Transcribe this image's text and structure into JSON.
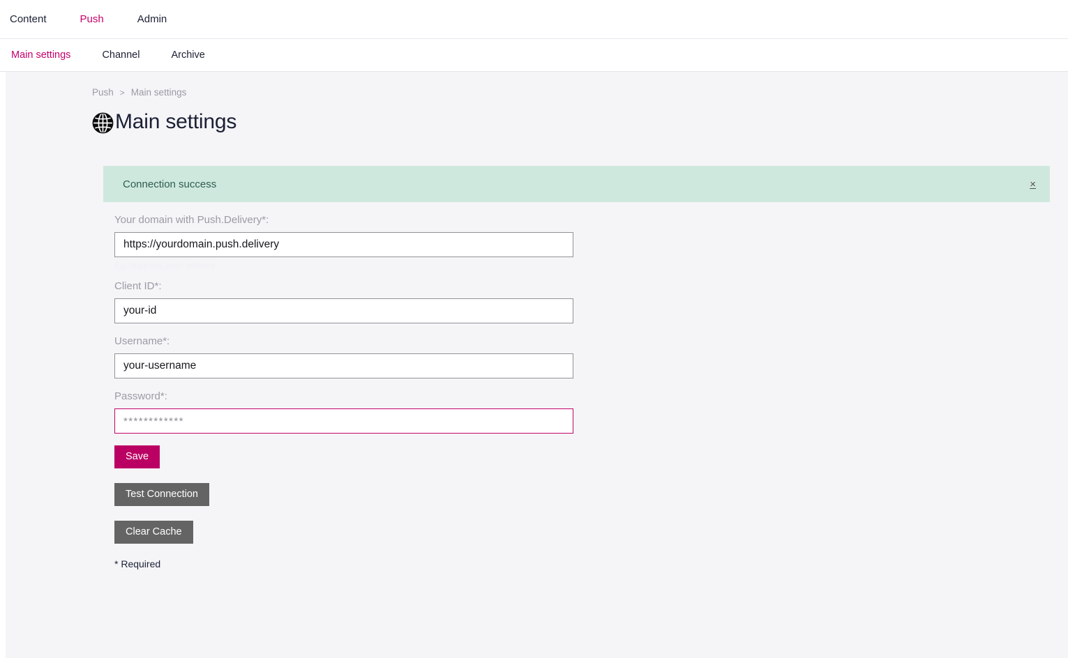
{
  "topnav": {
    "items": [
      {
        "label": "Content",
        "active": false
      },
      {
        "label": "Push",
        "active": true
      },
      {
        "label": "Admin",
        "active": false
      }
    ]
  },
  "subnav": {
    "items": [
      {
        "label": "Main settings",
        "active": true
      },
      {
        "label": "Channel",
        "active": false
      },
      {
        "label": "Archive",
        "active": false
      }
    ]
  },
  "breadcrumb": {
    "parent": "Push",
    "separator": ">",
    "current": "Main settings"
  },
  "page": {
    "title": "Main settings",
    "icon": "globe-icon"
  },
  "alert": {
    "message": "Connection success",
    "close_label": "×",
    "background": "#cfe8de",
    "text_color": "#2c5d50"
  },
  "form": {
    "fields": [
      {
        "label": "Your domain with Push.Delivery*:",
        "value": "https://yourdomain.push.delivery",
        "placeholder": "https://yourdomain.push.delivery",
        "hint": "Eg: https://ez.push.delivery",
        "focused": false,
        "masked": false
      },
      {
        "label": "Client ID*:",
        "value": "your-id",
        "placeholder": "your-id",
        "hint": "",
        "focused": false,
        "masked": false
      },
      {
        "label": "Username*:",
        "value": "your-username",
        "placeholder": "your-username",
        "hint": "",
        "focused": false,
        "masked": false
      },
      {
        "label": "Password*:",
        "value": "************",
        "placeholder": "************",
        "hint": "",
        "focused": true,
        "masked": true
      }
    ],
    "buttons": [
      {
        "label": "Save",
        "style": "primary"
      },
      {
        "label": "Test Connection",
        "style": "secondary"
      },
      {
        "label": "Clear Cache",
        "style": "secondary"
      }
    ],
    "required_note": "* Required"
  },
  "colors": {
    "accent": "#c4006b",
    "primary_button": "#bb0063",
    "secondary_button": "#646464",
    "success_bg": "#cfe8de",
    "page_bg": "#f5f5f8"
  }
}
